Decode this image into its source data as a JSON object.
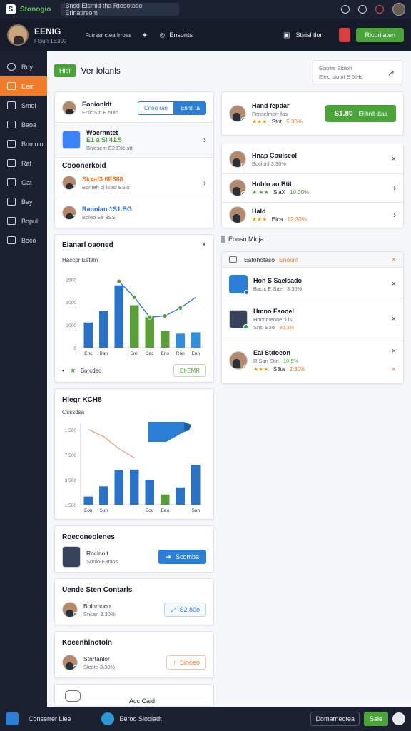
{
  "topbar": {
    "app_name": "Stonogio",
    "search_text": "Bnsd Elsmid tha Rtosotoso Erlnatirsom"
  },
  "profile": {
    "name": "EENIG",
    "subtitle": "Ftsun 1E300",
    "meta": "Futrssr ctea frroes",
    "link_label": "Ensonts",
    "secondary_label": "Stirisl tlon",
    "action_label": "Ricorilaten"
  },
  "sidebar": {
    "items": [
      "Roy",
      "Eem",
      "Smol",
      "Baoa",
      "Bomoio",
      "Rat",
      "Gat",
      "Bay",
      "Bopul",
      "Boco"
    ]
  },
  "header": {
    "tag": "Hldi",
    "title": "Ver lolanls",
    "info_line1": "Ecorlrs Elbloh",
    "info_line2": "Elecl stomt E 5tHs"
  },
  "left_list": {
    "row1": {
      "title": "Eonionldt",
      "sub": "Enlc Sltt E 50ln",
      "seg_a": "Cnoo ran",
      "seg_b": "Enhtl ta"
    },
    "row2": {
      "title": "Woerhntet",
      "line2": "E1 a Sl  41.5",
      "sub": "Bnlcsem  E2 Etlc stt"
    },
    "row3_title": "Cooonerkoid",
    "row3": {
      "title": "Skxaf3 6E388",
      "sub": "Bonteh ol lsosl BSlo"
    },
    "row4": {
      "title": "Ranolan 1S1.BG",
      "sub": "Boleb Elr  3SS"
    }
  },
  "chart1": {
    "title": "Eianarl oaoned",
    "subtitle": "Haccpr Eetaln",
    "legend": "Borcdeo",
    "button": "Et-EMR",
    "chart_data": {
      "type": "bar",
      "title": "Eianarl oaoned",
      "categories": [
        "Enc",
        "Ban",
        "",
        "Enn",
        "Cac",
        "Eno",
        "Rnn",
        "Enn"
      ],
      "values": [
        950,
        1380,
        2350,
        1600,
        1150,
        620,
        530,
        580
      ],
      "colors": [
        "#2a72c8",
        "#2a72c8",
        "#2a72c8",
        "#5a9e3a",
        "#5a9e3a",
        "#5a9e3a",
        "#2f8fdc",
        "#2f8fdc"
      ],
      "ylim": [
        0,
        2800
      ],
      "yticks": [
        "0",
        "2000",
        "3000",
        "2500"
      ],
      "line_values": [
        null,
        null,
        2500,
        1900,
        1150,
        1200,
        1500,
        1900
      ]
    }
  },
  "chart2": {
    "title": "Hlegr KCH8",
    "subtitle": "Osssdsa",
    "chart_data": {
      "type": "bar",
      "title": "Hlegr KCH8",
      "categories": [
        "Eou",
        "Sun",
        "",
        "",
        "Eou",
        "Eeu",
        "",
        "Snn"
      ],
      "values": [
        800,
        1800,
        3400,
        3450,
        2450,
        1000,
        1700,
        3900
      ],
      "colors": [
        "#2a72c8",
        "#2a72c8",
        "#2a72c8",
        "#2a72c8",
        "#2a72c8",
        "#5a9e3a",
        "#2a72c8",
        "#2a72c8"
      ],
      "ylim": [
        0,
        8000
      ],
      "yticks": [
        "1.500",
        "3.500",
        "7.500",
        "1.500"
      ],
      "line_values": [
        7400,
        6700,
        5500,
        4600
      ]
    }
  },
  "card_a": {
    "title": "Roeconeolenes",
    "line1": "Rnclnolt",
    "line2": "Sonlo  E8nlos",
    "button": "Scomba"
  },
  "card_b": {
    "title": "Uende Sten Contarls",
    "line1": "Bolnmoco",
    "line2": "Sncan  3.30%",
    "button": "S2.80o"
  },
  "card_c": {
    "title": "Koeenhlnotoln",
    "line1": "Stnrtanlor",
    "line2": "Slcote  3.30%",
    "button": "Sinoeo"
  },
  "card_d": {
    "label": "Acc Caid"
  },
  "right_top": {
    "title": "Hand fepdar",
    "sub": "Fenselmorr fas",
    "stars": "★★★",
    "value": "Stot",
    "percent": "5.30%",
    "button_value": "S1.80",
    "button_label": "Ehhnlt dtaa"
  },
  "right_list": [
    {
      "title": "Hnap Coulseol",
      "sub": "Boclonl  3.30%"
    },
    {
      "title": "Hoblo ao Btit",
      "stars": "★ ★★",
      "value": "SlaX",
      "percent": "10.30%"
    },
    {
      "title": "Hald",
      "stars": "★★★",
      "value": "Elca",
      "percent": "12.30%"
    }
  ],
  "section": {
    "label": "Eonso Mloja"
  },
  "notifications": {
    "header_left": "Eatohotaso",
    "header_right": "Enosnl",
    "items": [
      {
        "title": "Hon S Saelsado",
        "line2": "Baclc E Sae",
        "percent": "3.30%"
      },
      {
        "title": "Hmno Faooel",
        "line2": "Hocomenoer l ls",
        "sub": "Snsl  S3o",
        "percent": "30.3%"
      },
      {
        "title": "Eal Stdoeon",
        "line2": "R.Sqn Stln",
        "percent": "10.5%",
        "stars": "★★★",
        "value": "S3ta",
        "percent2": "2.30%"
      }
    ]
  },
  "bottombar": {
    "left_label": "Conserrer Llee",
    "mid_label": "Eeroo Slooladt",
    "btn_outline": "Domarneotea",
    "btn_green": "Sale"
  },
  "colors": {
    "accent_orange": "#f07b2b",
    "accent_green": "#4aa43a",
    "accent_blue": "#2a7ed6",
    "dark_bg": "#1b2130"
  }
}
